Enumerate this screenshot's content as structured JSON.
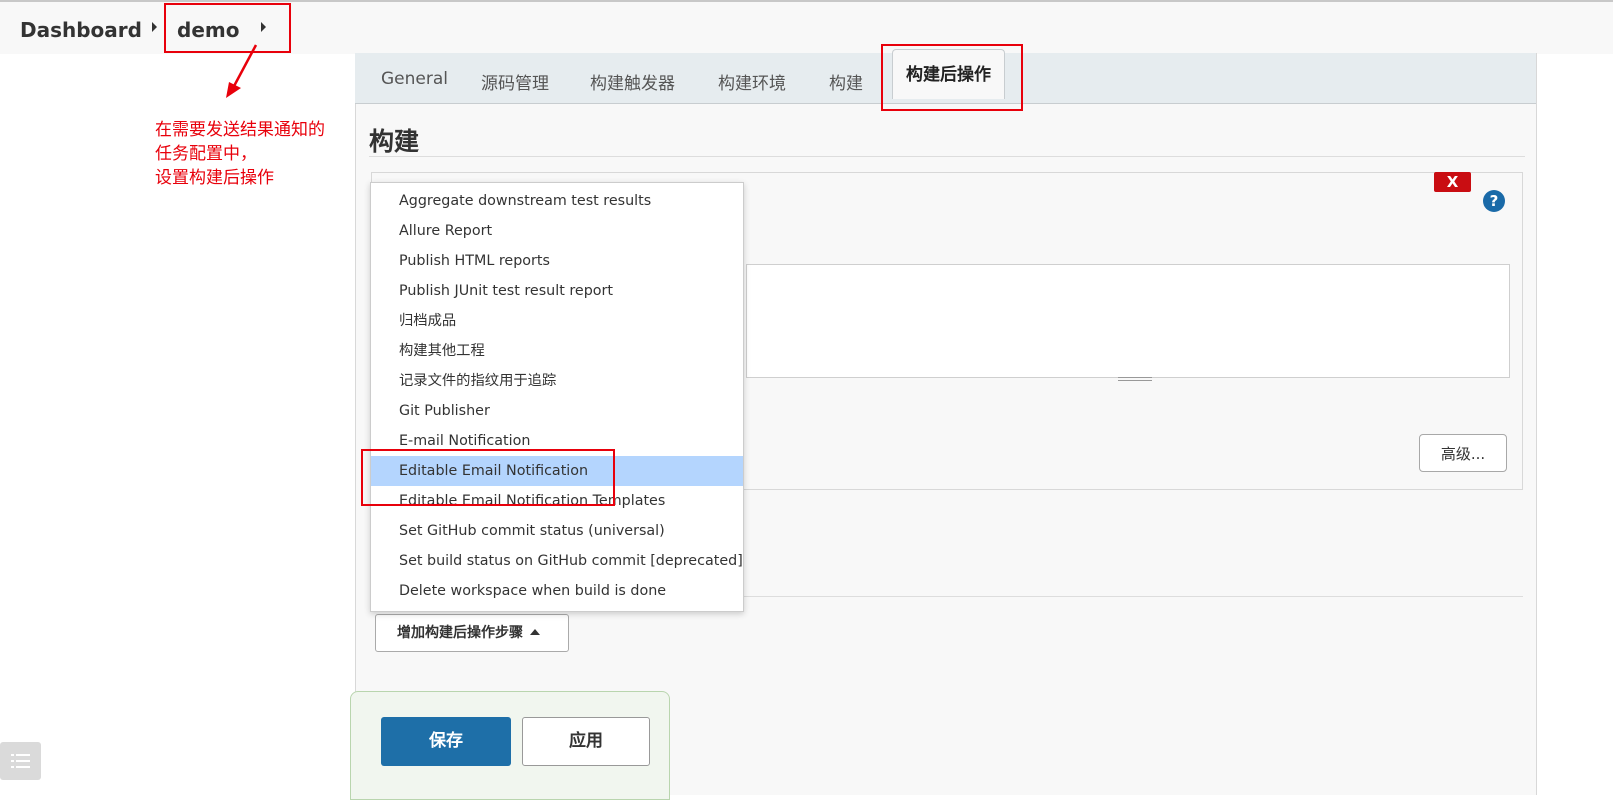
{
  "breadcrumb": {
    "dashboard": "Dashboard",
    "job": "demo"
  },
  "annotation": {
    "text": "在需要发送结果通知的\n任务配置中，\n设置构建后操作"
  },
  "tabs": [
    {
      "label": "General"
    },
    {
      "label": "源码管理"
    },
    {
      "label": "构建触发器"
    },
    {
      "label": "构建环境"
    },
    {
      "label": "构建"
    },
    {
      "label": "构建后操作",
      "active": true
    }
  ],
  "section": {
    "title": "构建"
  },
  "step": {
    "delete_label": "X",
    "help_label": "?",
    "advanced_label": "高级..."
  },
  "dropdown": {
    "items": [
      {
        "label": "Aggregate downstream test results"
      },
      {
        "label": "Allure Report"
      },
      {
        "label": "Publish HTML reports"
      },
      {
        "label": "Publish JUnit test result report"
      },
      {
        "label": "归档成品"
      },
      {
        "label": "构建其他工程"
      },
      {
        "label": "记录文件的指纹用于追踪"
      },
      {
        "label": "Git Publisher"
      },
      {
        "label": "E-mail Notification"
      },
      {
        "label": "Editable Email Notification",
        "highlighted": true
      },
      {
        "label": "Editable Email Notification Templates"
      },
      {
        "label": "Set GitHub commit status (universal)"
      },
      {
        "label": "Set build status on GitHub commit [deprecated]"
      },
      {
        "label": "Delete workspace when build is done"
      }
    ]
  },
  "add_step": {
    "label": "增加构建后操作步骤"
  },
  "footer": {
    "save_label": "保存",
    "apply_label": "应用"
  },
  "colors": {
    "annotation_red": "#e8000b",
    "primary_blue": "#1e6fa8",
    "highlight": "#b4d5fe"
  }
}
